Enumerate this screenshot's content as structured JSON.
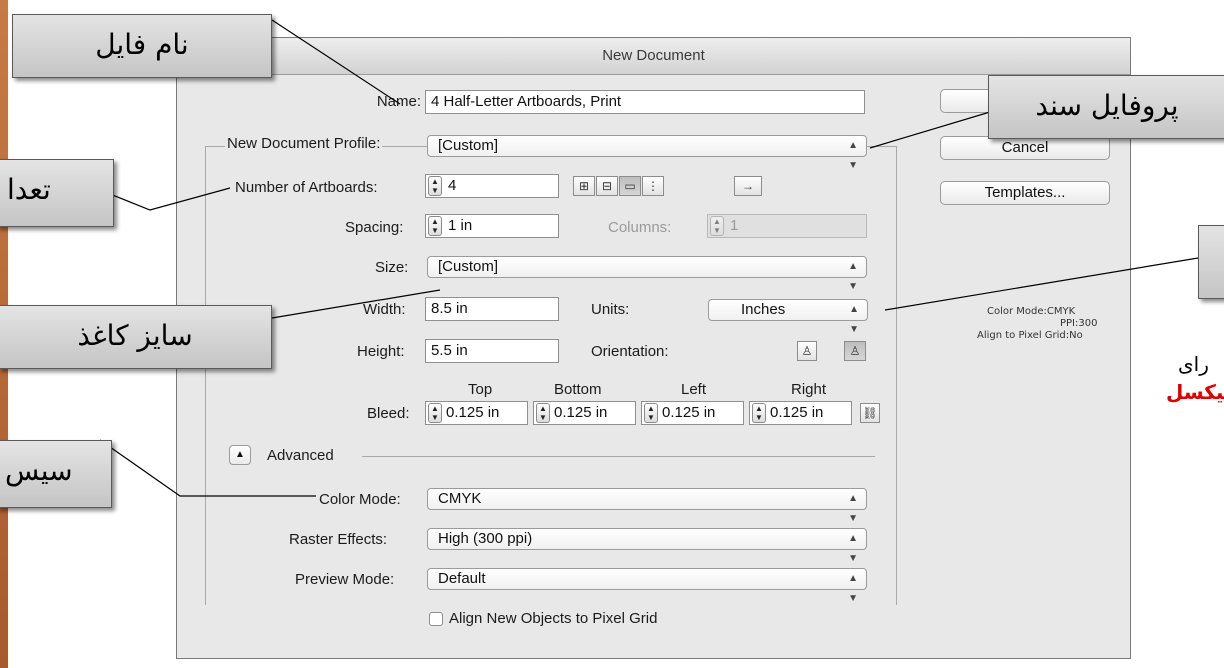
{
  "dialog": {
    "title": "New Document",
    "name_label": "Name:",
    "name_value": "4 Half-Letter Artboards, Print",
    "profile_label": "New Document Profile:",
    "profile_value": "[Custom]",
    "artboards_label": "Number of Artboards:",
    "artboards_value": "4",
    "spacing_label": "Spacing:",
    "spacing_value": "1 in",
    "columns_label": "Columns:",
    "columns_value": "1",
    "size_label": "Size:",
    "size_value": "[Custom]",
    "width_label": "Width:",
    "width_value": "8.5 in",
    "units_label": "Units:",
    "units_value": "Inches",
    "height_label": "Height:",
    "height_value": "5.5 in",
    "orientation_label": "Orientation:",
    "bleed_label": "Bleed:",
    "bleed_headers": [
      "Top",
      "Bottom",
      "Left",
      "Right"
    ],
    "bleed_values": [
      "0.125 in",
      "0.125 in",
      "0.125 in",
      "0.125 in"
    ],
    "advanced_label": "Advanced",
    "color_mode_label": "Color Mode:",
    "color_mode_value": "CMYK",
    "raster_label": "Raster Effects:",
    "raster_value": "High (300 ppi)",
    "preview_label": "Preview Mode:",
    "preview_value": "Default",
    "align_checkbox_label": "Align New Objects to Pixel Grid",
    "cancel_label": "Cancel",
    "templates_label": "Templates...",
    "info_color_mode": "Color Mode:CMYK",
    "info_ppi": "PPI:300",
    "info_align": "Align to Pixel Grid:No"
  },
  "callouts": {
    "file_name": "نام فایل",
    "doc_profile": "پروفایل سند",
    "artboards_count": "تعدا",
    "paper_size": "سایز کاغذ",
    "color_system": "سیس"
  },
  "side_text": {
    "line1": "رای",
    "line2": "پیکسل"
  },
  "icons": {
    "stepper": "up-down-stepper-icon",
    "select_arrow": "up-down-chevron-icon",
    "advanced_toggle": "disclosure-triangle-icon"
  }
}
